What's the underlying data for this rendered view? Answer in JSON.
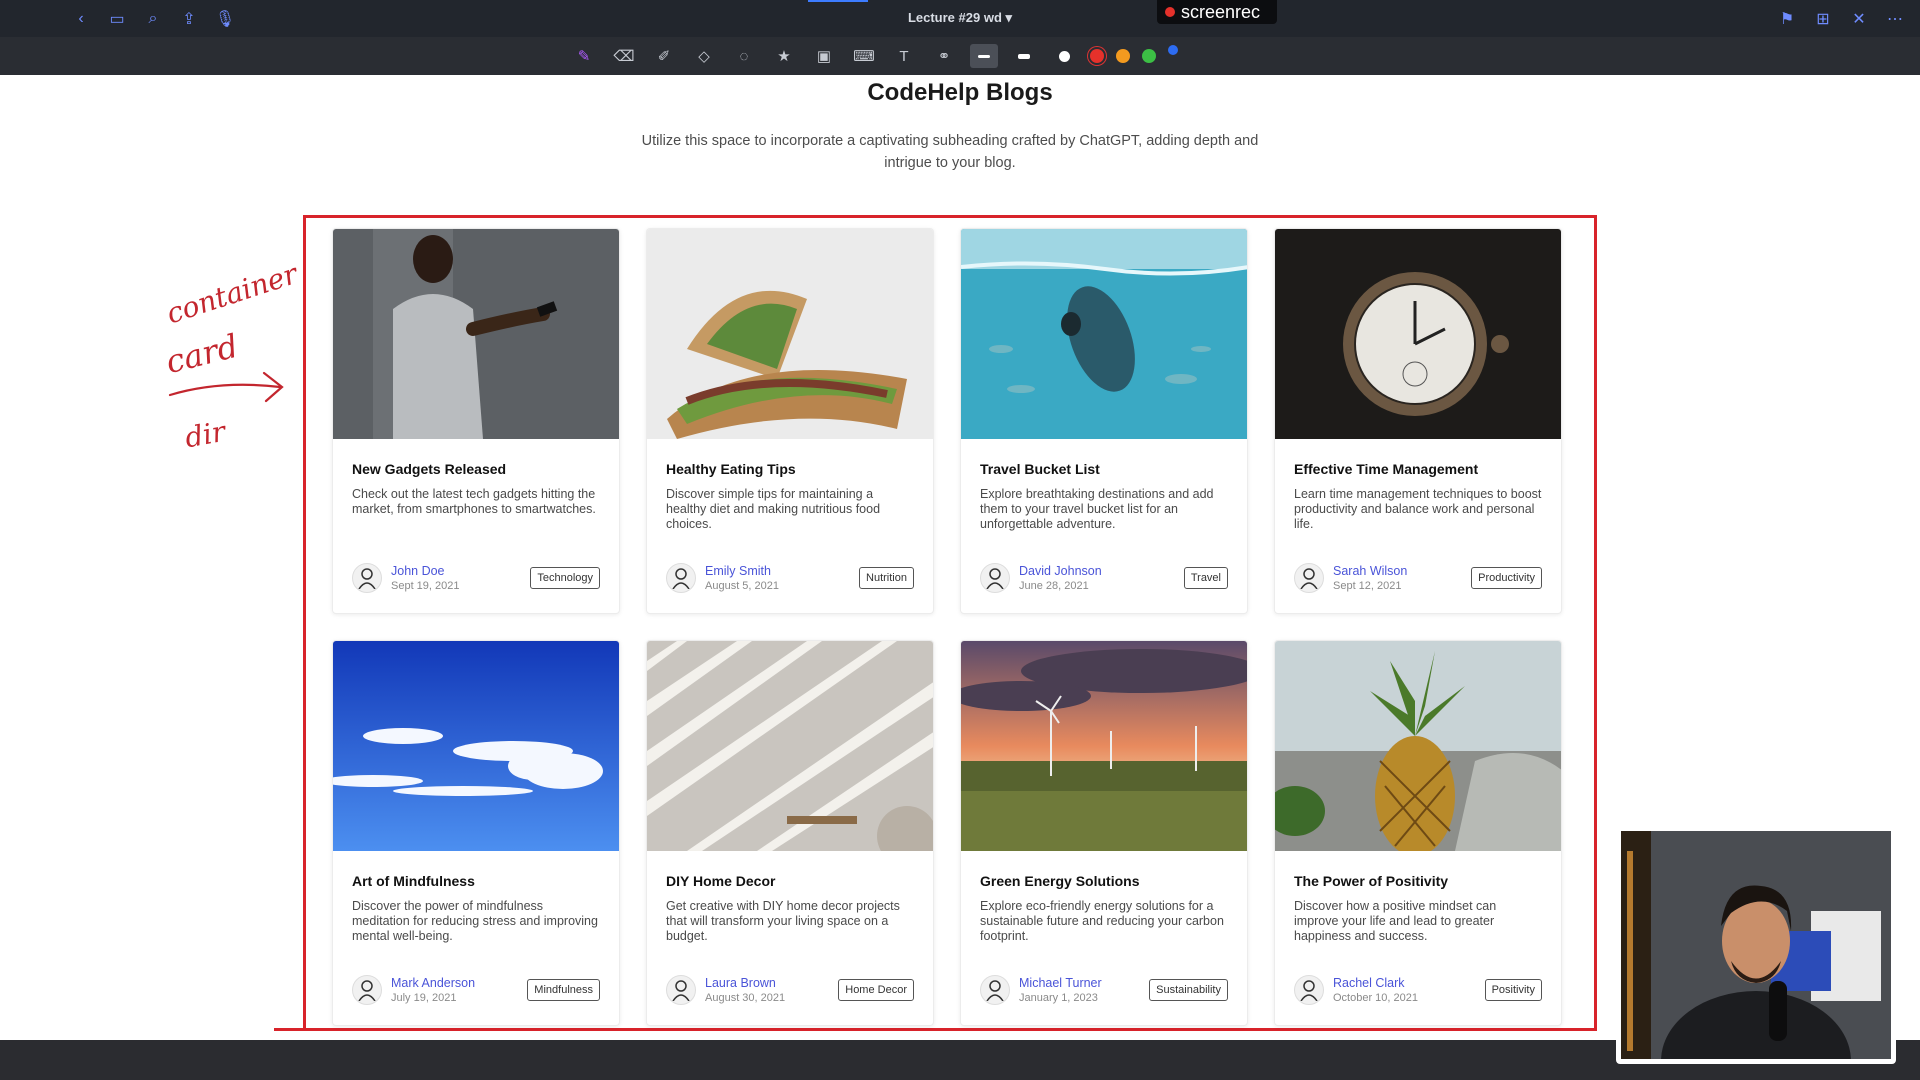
{
  "window": {
    "title": "Lecture #29 wd",
    "recorder_label": "screenrec"
  },
  "page": {
    "title": "CodeHelp Blogs",
    "subtitle": "Utilize this space to incorporate a captivating subheading crafted by ChatGPT, adding depth and intrigue to your blog."
  },
  "annotation": {
    "lines": [
      "container",
      "card",
      "dir"
    ]
  },
  "colors": {
    "accent": "#3d7cff",
    "frame_red": "#d8232a",
    "author_link": "#4a54d8",
    "swatches": [
      "#e5312b",
      "#f39a1f",
      "#3cbf45",
      "#2d6cf2"
    ]
  },
  "cards": [
    {
      "title": "New Gadgets Released",
      "desc": "Check out the latest tech gadgets hitting the market, from smartphones to smartwatches.",
      "author": "John Doe",
      "date": "Sept 19, 2021",
      "tag": "Technology",
      "image": "man-phone"
    },
    {
      "title": "Healthy Eating Tips",
      "desc": "Discover simple tips for maintaining a healthy diet and making nutritious food choices.",
      "author": "Emily Smith",
      "date": "August 5, 2021",
      "tag": "Nutrition",
      "image": "sandwich"
    },
    {
      "title": "Travel Bucket List",
      "desc": "Explore breathtaking destinations and add them to your travel bucket list for an unforgettable adventure.",
      "author": "David Johnson",
      "date": "June 28, 2021",
      "tag": "Travel",
      "image": "swimmer"
    },
    {
      "title": "Effective Time Management",
      "desc": "Learn time management techniques to boost productivity and balance work and personal life.",
      "author": "Sarah Wilson",
      "date": "Sept 12, 2021",
      "tag": "Productivity",
      "image": "pocket-watch"
    },
    {
      "title": "Art of Mindfulness",
      "desc": "Discover the power of mindfulness meditation for reducing stress and improving mental well-being.",
      "author": "Mark Anderson",
      "date": "July 19, 2021",
      "tag": "Mindfulness",
      "image": "sky-clouds"
    },
    {
      "title": "DIY Home Decor",
      "desc": "Get creative with DIY home decor projects that will transform your living space on a budget.",
      "author": "Laura Brown",
      "date": "August 30, 2021",
      "tag": "Home Decor",
      "image": "shadow-stripes"
    },
    {
      "title": "Green Energy Solutions",
      "desc": "Explore eco-friendly energy solutions for a sustainable future and reducing your carbon footprint.",
      "author": "Michael Turner",
      "date": "January 1, 2023",
      "tag": "Sustainability",
      "image": "wind-turbines"
    },
    {
      "title": "The Power of Positivity",
      "desc": "Discover how a positive mindset can improve your life and lead to greater happiness and success.",
      "author": "Rachel Clark",
      "date": "October 10, 2021",
      "tag": "Positivity",
      "image": "pineapple"
    }
  ]
}
